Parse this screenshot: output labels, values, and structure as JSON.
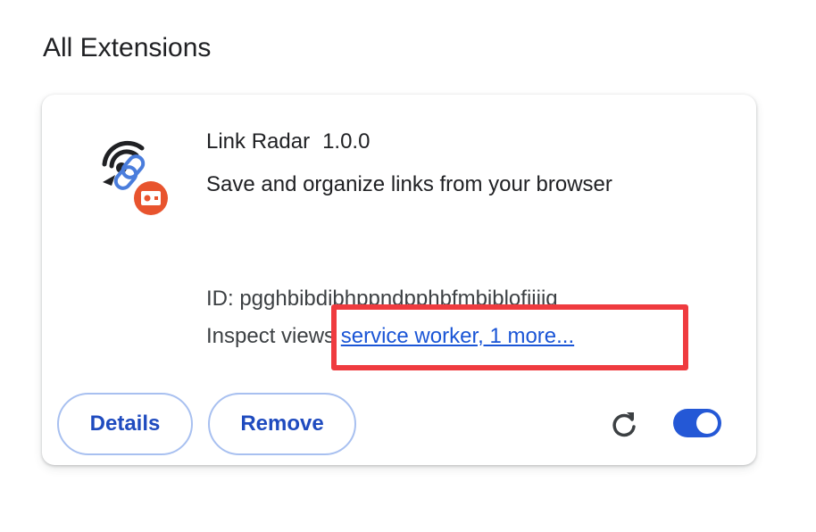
{
  "section": {
    "title": "All Extensions"
  },
  "extension": {
    "icon": "link-radar-extension-icon",
    "badge_icon": "unpacked-extension-badge-icon",
    "name": "Link Radar",
    "version": "1.0.0",
    "description": "Save and organize links from your browser",
    "id_text": "ID: pgghbibdibhppndpphbfmbiblofiiiig",
    "inspect_label": "Inspect views",
    "inspect_link": "service worker, 1 more...",
    "enabled": true
  },
  "buttons": {
    "details_label": "Details",
    "remove_label": "Remove",
    "reload_icon": "reload-icon"
  },
  "colors": {
    "accent": "#1a55d6",
    "toggle_on": "#2458d6",
    "badge": "#e8542e",
    "highlight": "#ef3b3f"
  }
}
